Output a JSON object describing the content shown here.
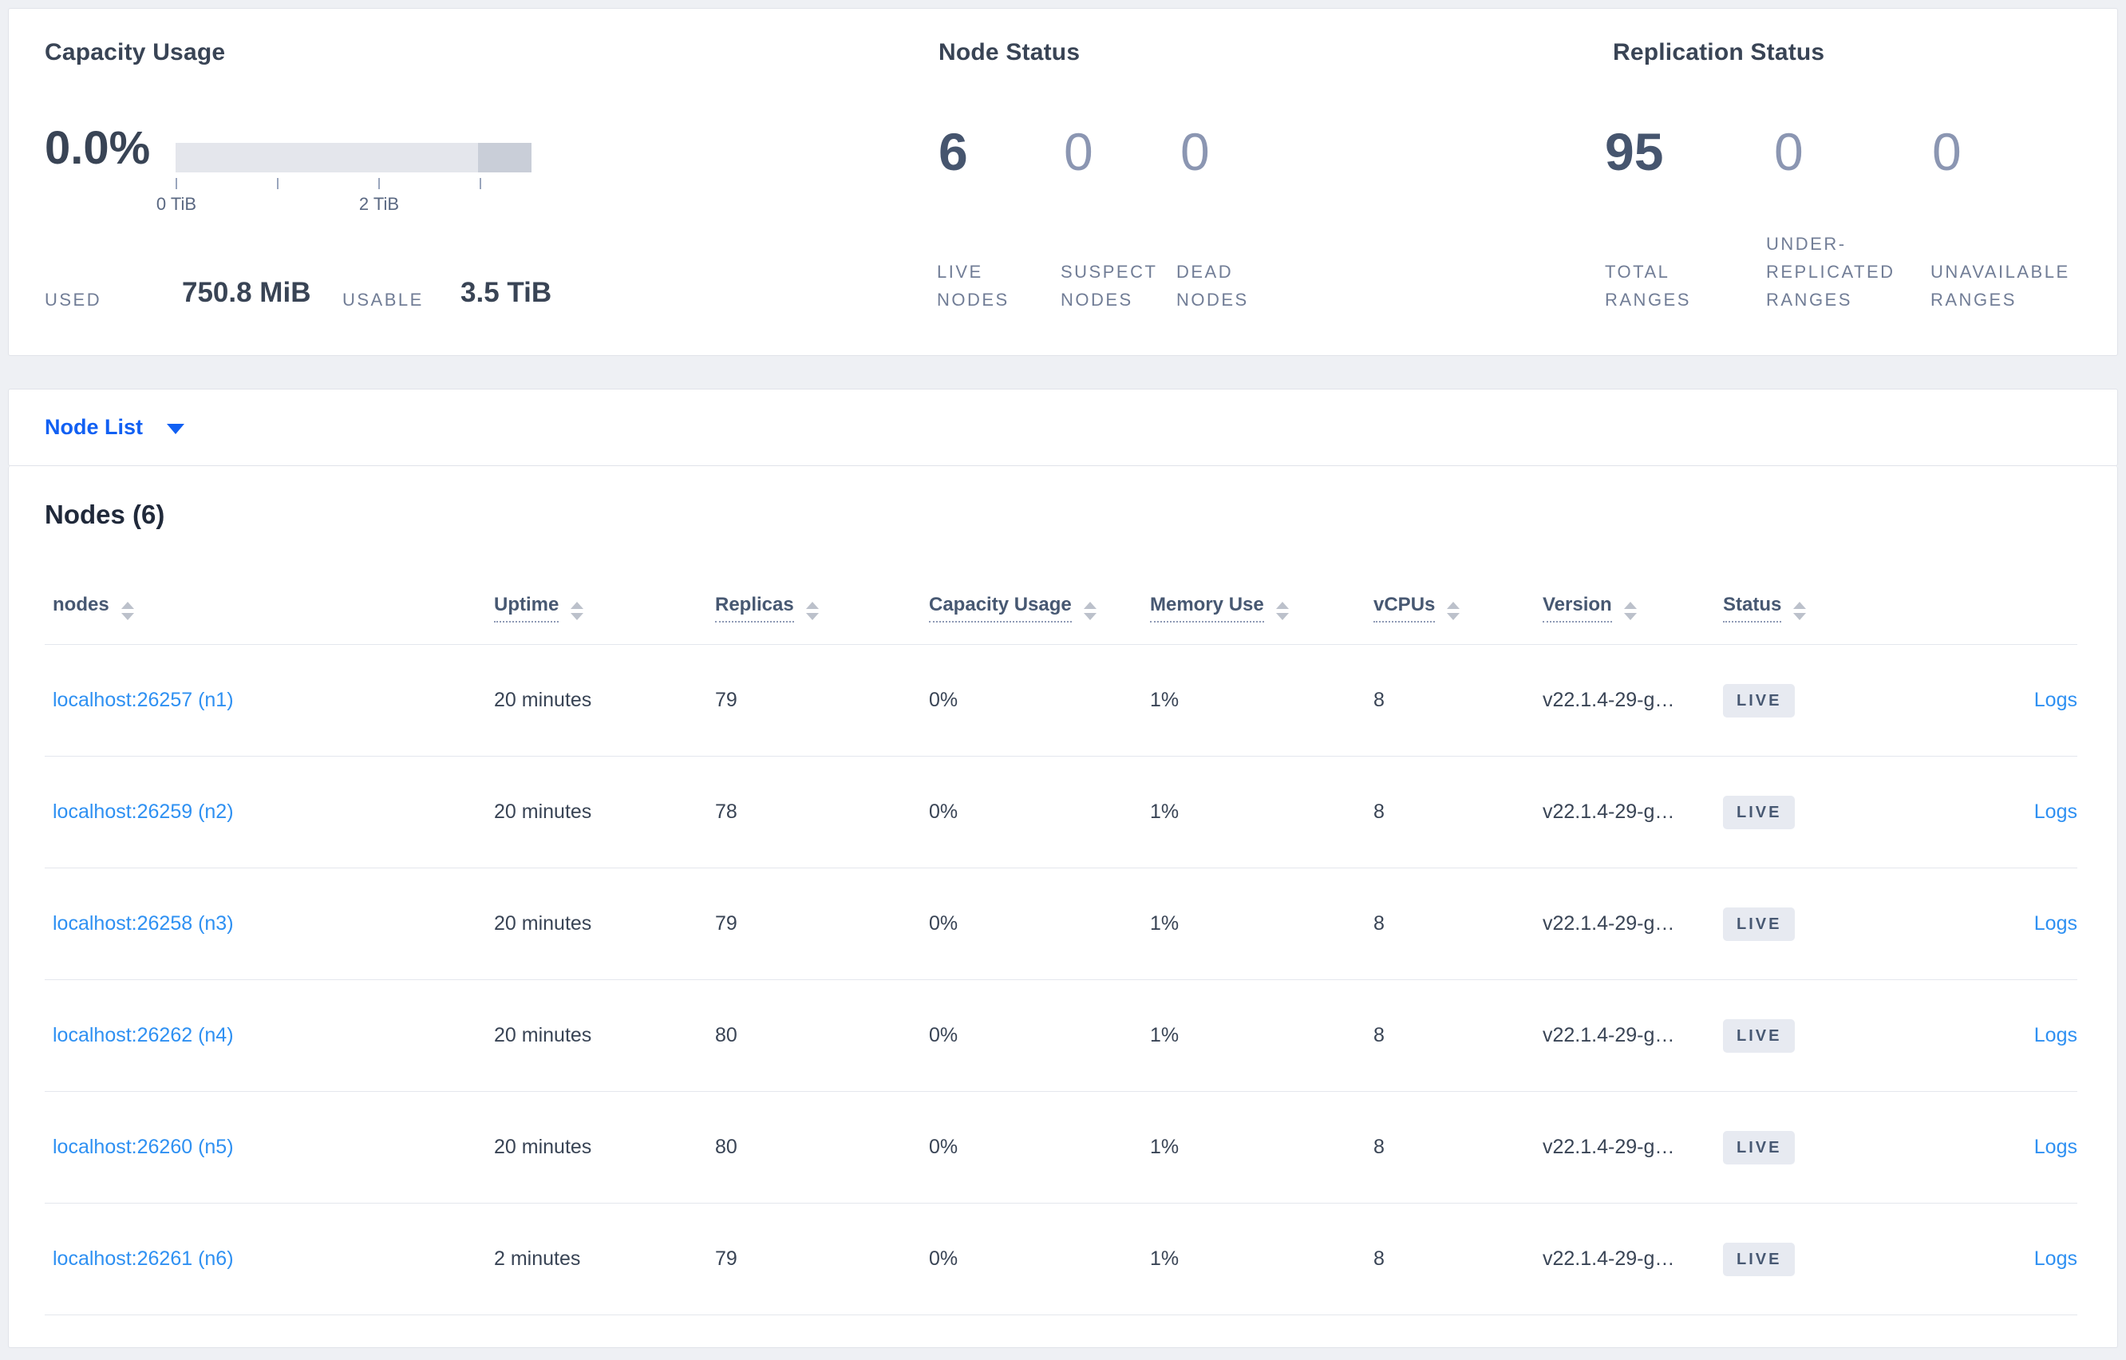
{
  "summary": {
    "capacity_usage": {
      "title": "Capacity Usage",
      "percent": "0.0%",
      "axis_tick_labels": [
        "0 TiB",
        "2 TiB"
      ],
      "used_label": "USED",
      "used_value": "750.8 MiB",
      "usable_label": "USABLE",
      "usable_value": "3.5 TiB",
      "bar_track_color": "#e4e6ec",
      "bar_reserved_color": "#c9ced8"
    },
    "node_status": {
      "title": "Node Status",
      "metrics": [
        {
          "value": "6",
          "label": "LIVE NODES"
        },
        {
          "value": "0",
          "label": "SUSPECT NODES"
        },
        {
          "value": "0",
          "label": "DEAD NODES"
        }
      ]
    },
    "replication_status": {
      "title": "Replication Status",
      "metrics": [
        {
          "value": "95",
          "label": "TOTAL RANGES"
        },
        {
          "value": "0",
          "label": "UNDER-REPLICATED RANGES"
        },
        {
          "value": "0",
          "label": "UNAVAILABLE RANGES"
        }
      ]
    }
  },
  "node_list_selector": {
    "label": "Node List",
    "accent_color": "#1160f3"
  },
  "nodes_table": {
    "heading": "Nodes (6)",
    "columns": [
      "nodes",
      "Uptime",
      "Replicas",
      "Capacity Usage",
      "Memory Use",
      "vCPUs",
      "Version",
      "Status"
    ],
    "logs_label": "Logs",
    "link_color": "#2e90f2",
    "live_badge_bg": "#e7eaf1",
    "live_badge_text_color": "#475872",
    "rows": [
      {
        "node": "localhost:26257 (n1)",
        "uptime": "20 minutes",
        "replicas": "79",
        "capacity": "0%",
        "memory": "1%",
        "vcpus": "8",
        "version": "v22.1.4-29-g…",
        "status": "LIVE"
      },
      {
        "node": "localhost:26259 (n2)",
        "uptime": "20 minutes",
        "replicas": "78",
        "capacity": "0%",
        "memory": "1%",
        "vcpus": "8",
        "version": "v22.1.4-29-g…",
        "status": "LIVE"
      },
      {
        "node": "localhost:26258 (n3)",
        "uptime": "20 minutes",
        "replicas": "79",
        "capacity": "0%",
        "memory": "1%",
        "vcpus": "8",
        "version": "v22.1.4-29-g…",
        "status": "LIVE"
      },
      {
        "node": "localhost:26262 (n4)",
        "uptime": "20 minutes",
        "replicas": "80",
        "capacity": "0%",
        "memory": "1%",
        "vcpus": "8",
        "version": "v22.1.4-29-g…",
        "status": "LIVE"
      },
      {
        "node": "localhost:26260 (n5)",
        "uptime": "20 minutes",
        "replicas": "80",
        "capacity": "0%",
        "memory": "1%",
        "vcpus": "8",
        "version": "v22.1.4-29-g…",
        "status": "LIVE"
      },
      {
        "node": "localhost:26261 (n6)",
        "uptime": "2 minutes",
        "replicas": "79",
        "capacity": "0%",
        "memory": "1%",
        "vcpus": "8",
        "version": "v22.1.4-29-g…",
        "status": "LIVE"
      }
    ]
  }
}
